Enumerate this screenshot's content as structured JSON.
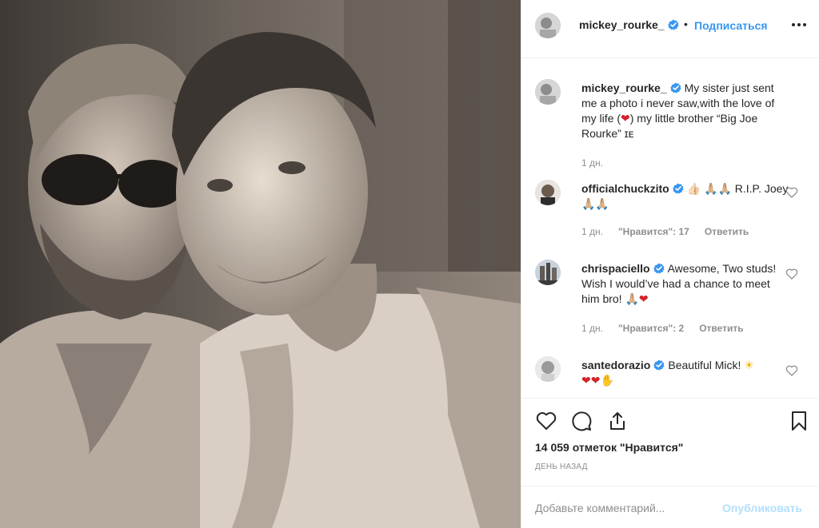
{
  "post": {
    "author": "mickey_rourke_",
    "follow_label": "Подписаться",
    "header_separator": "•",
    "photo_icon": "sepia-photo-two-men",
    "caption": {
      "username": "mickey_rourke_",
      "text_before_heart": "My sister just sent me a photo i never saw,with the love of my life (",
      "heart": "❤",
      "text_after_heart": ") my little brother “Big Joe Rourke” ɪᴇ",
      "time": "1 дн."
    }
  },
  "comments": [
    {
      "username": "officialchuckzito",
      "text": "👍🏻 🙏🏼🙏🏼 R.I.P. Joey🙏🏼🙏🏼",
      "time": "1 дн.",
      "likes": "\"Нравится\": 17",
      "reply": "Ответить"
    },
    {
      "username": "chrispaciello",
      "text_before": "Awesome, Two studs! Wish I would’ve had a chance to meet him bro! ",
      "emoji": "🙏🏼",
      "heart": "❤",
      "time": "1 дн.",
      "likes": "\"Нравится\": 2",
      "reply": "Ответить"
    },
    {
      "username": "santedorazio",
      "text": "Beautiful Mick! ",
      "sun": "☀",
      "line2_hearts": "❤❤",
      "line2_hand": "✋",
      "time": "",
      "likes": "",
      "reply": ""
    }
  ],
  "actions": {
    "likes_count": "14 059 отметок \"Нравится\"",
    "time_ago": "ДЕНЬ НАЗАД"
  },
  "add_comment": {
    "placeholder": "Добавьте комментарий...",
    "publish_label": "Опубликовать"
  },
  "colors": {
    "link_blue": "#3897f0",
    "verified_blue": "#3897f0",
    "publish_disabled": "#b2dffc",
    "muted_text": "#8e8e8e",
    "text": "#262626",
    "divider": "#efefef",
    "heart_red": "#d1232a"
  },
  "icons": {
    "verified": "verified-badge-icon",
    "more": "more-options-icon",
    "comment_like": "heart-outline-icon",
    "like": "heart-icon",
    "comment": "comment-bubble-icon",
    "share": "share-icon",
    "save": "bookmark-icon"
  }
}
